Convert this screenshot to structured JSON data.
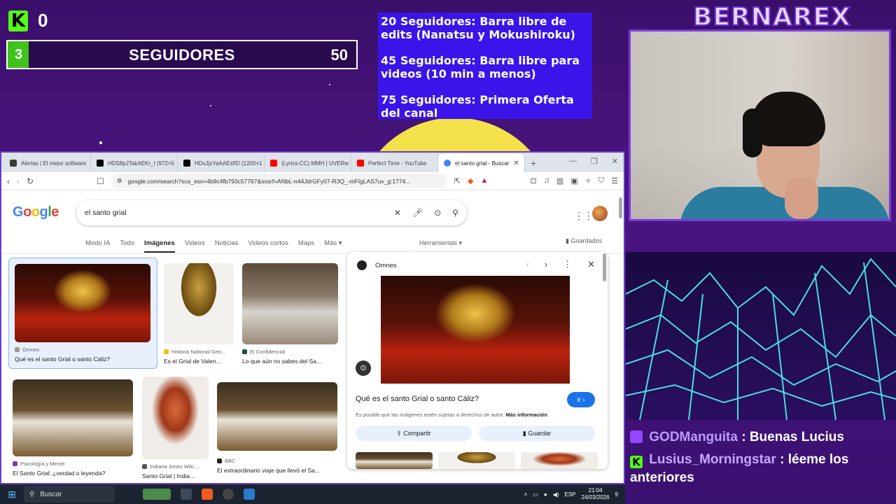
{
  "overlay": {
    "kick_count": "0",
    "goal": {
      "current": "3",
      "label": "SEGUIDORES",
      "max": "50",
      "progress": 0.06
    },
    "announcements": [
      "20 Seguidores: Barra libre de edits (Nanatsu y Mokushiroku)",
      "45 Seguidores: Barra libre para videos (10 min a menos)",
      "75 Seguidores: Primera Oferta del canal"
    ],
    "brand": "BERNAREX"
  },
  "chat": [
    {
      "platform": "twitch",
      "user": "GODManguita",
      "message": ": Buenas Lucius"
    },
    {
      "platform": "kick",
      "user": "Lusius_Morningstar",
      "message": ": léeme los anteriores"
    }
  ],
  "browser": {
    "tabs": [
      {
        "label": "Alertas | El mejor software",
        "icon": "stream-icon",
        "color": "#3a3a3a"
      },
      {
        "label": "HDS8pJTakAEKr_I (972×5",
        "icon": "x-icon",
        "color": "#000000"
      },
      {
        "label": "HDxJjxYaAAEsfID (1200×1",
        "icon": "x-icon",
        "color": "#000000"
      },
      {
        "label": "(Lyrics-CC) MMH | UVERw",
        "icon": "youtube-icon",
        "color": "#ff0000"
      },
      {
        "label": "Perfect Time - YouTube",
        "icon": "youtube-icon",
        "color": "#ff0000"
      },
      {
        "label": "el santo grial - Buscar",
        "icon": "google-icon",
        "color": "#4285f4",
        "active": true
      }
    ],
    "url": "google.com/search?sca_esv=4b9c4fb793c57767&sxsrf=ANbL-n44JdrGFy07-R3Q_-mFIgLAS7uv_g:1774..."
  },
  "google": {
    "logo": "Google",
    "query": "el santo grial",
    "tabs": [
      "Modo IA",
      "Todo",
      "Imágenes",
      "Videos",
      "Noticias",
      "Videos cortos",
      "Maps",
      "Más ▾"
    ],
    "active_tab": "Imágenes",
    "tools": "Herramientas ▾",
    "saved": "Guardados",
    "results": [
      {
        "source": "Omnes",
        "title": "Qué es el santo Grial o santo Cáliz?"
      },
      {
        "source": "Historia National Geo...",
        "title": "Es el Grial de Valen..."
      },
      {
        "source": "El Confidencial",
        "title": "Lo que aún no sabes del Sa..."
      },
      {
        "source": "Psicología y Mente",
        "title": "El Santo Grial: ¿verdad o leyenda?"
      },
      {
        "source": "Indiana Jones Wiki ...",
        "title": "Santo Grial | India..."
      },
      {
        "source": "BBC",
        "title": "El extraordinario viaje que llevó el Sa..."
      }
    ],
    "preview": {
      "source": "Omnes",
      "title": "Qué es el santo Grial o santo Cáliz?",
      "go": "Ir ›",
      "note": "Es posible que las imágenes estén sujetas a derechos de autor.",
      "more_info": "Más información",
      "share": "Compartir",
      "save": "Guardar"
    }
  },
  "taskbar": {
    "search": "Buscar",
    "lang": "ESP",
    "time": "21:04",
    "date": "24/03/2026",
    "notif": "9"
  }
}
